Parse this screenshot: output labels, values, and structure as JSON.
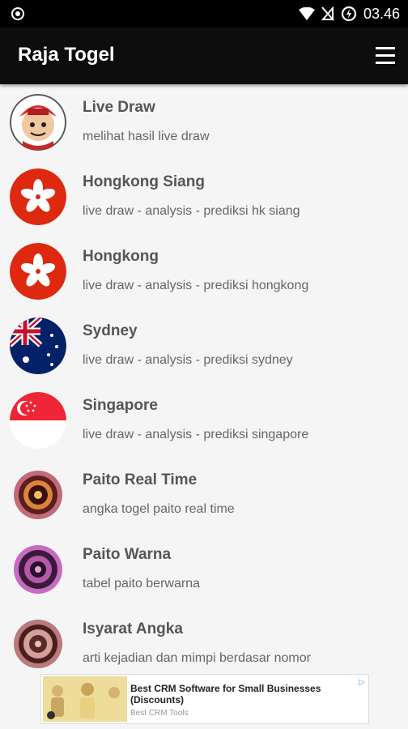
{
  "status_bar": {
    "time": "03.46"
  },
  "app_bar": {
    "title": "Raja Togel"
  },
  "items": [
    {
      "title": "Live Draw",
      "subtitle": "melihat hasil live draw"
    },
    {
      "title": "Hongkong Siang",
      "subtitle": "live draw - analysis - prediksi hk siang"
    },
    {
      "title": "Hongkong",
      "subtitle": "live draw - analysis - prediksi hongkong"
    },
    {
      "title": "Sydney",
      "subtitle": "live draw - analysis - prediksi sydney"
    },
    {
      "title": "Singapore",
      "subtitle": "live draw - analysis - prediksi singapore"
    },
    {
      "title": "Paito Real Time",
      "subtitle": "angka togel paito real time"
    },
    {
      "title": "Paito Warna",
      "subtitle": "tabel paito berwarna"
    },
    {
      "title": "Isyarat Angka",
      "subtitle": "arti kejadian dan mimpi berdasar nomor"
    }
  ],
  "ad": {
    "title": "Best CRM Software for Small Businesses (Discounts)",
    "source": "Best CRM Tools"
  },
  "colors": {
    "app_bar": "#0d0d0d",
    "hk_red": "#de2910",
    "sg_red": "#ee2536",
    "au_blue": "#012169"
  }
}
